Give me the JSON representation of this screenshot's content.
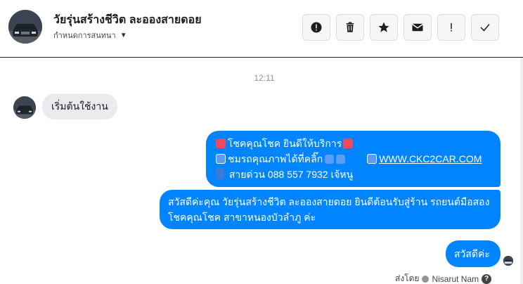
{
  "header": {
    "name": "วัยรุ่นสร้างชีวิต ละอองสายดอย",
    "subtitle": "กำหนดการสนทนา",
    "toolbar": [
      {
        "icon": "alert-circle-icon"
      },
      {
        "icon": "trash-icon"
      },
      {
        "icon": "star-icon"
      },
      {
        "icon": "mail-icon"
      },
      {
        "icon": "exclamation-icon"
      },
      {
        "icon": "check-icon"
      }
    ]
  },
  "conversation": {
    "timestamp": "12:11",
    "incoming": [
      {
        "text": "เริ่มต้นใช้งาน"
      }
    ],
    "outgoing": [
      {
        "line1": "โชคคุณโชค ยินดีให้บริการ",
        "line2_text": "ชมรถคุณภาพได้ที่คลิ๊ก",
        "line2_link": "WWW.CKC2CAR.COM",
        "line3": "สายด่วน 088 557 7932 เจ้หนู"
      },
      {
        "text": "สวัสดีค่ะคุณ วัยรุ่นสร้างชีวิต ละอองสายดอย ยินดีต้อนรับสู่ร้าน รถยนต์มือสอง โชคคุณโชค สาขาหนองบัวลำภู ค่ะ"
      },
      {
        "text": "สวัสดีค่ะ"
      }
    ],
    "sent_by_label": "ส่งโดย",
    "sent_by_name": "Nisarut Nam"
  },
  "colors": {
    "outgoing_bubble": "#0084ff",
    "incoming_bubble": "#e9ebee"
  }
}
